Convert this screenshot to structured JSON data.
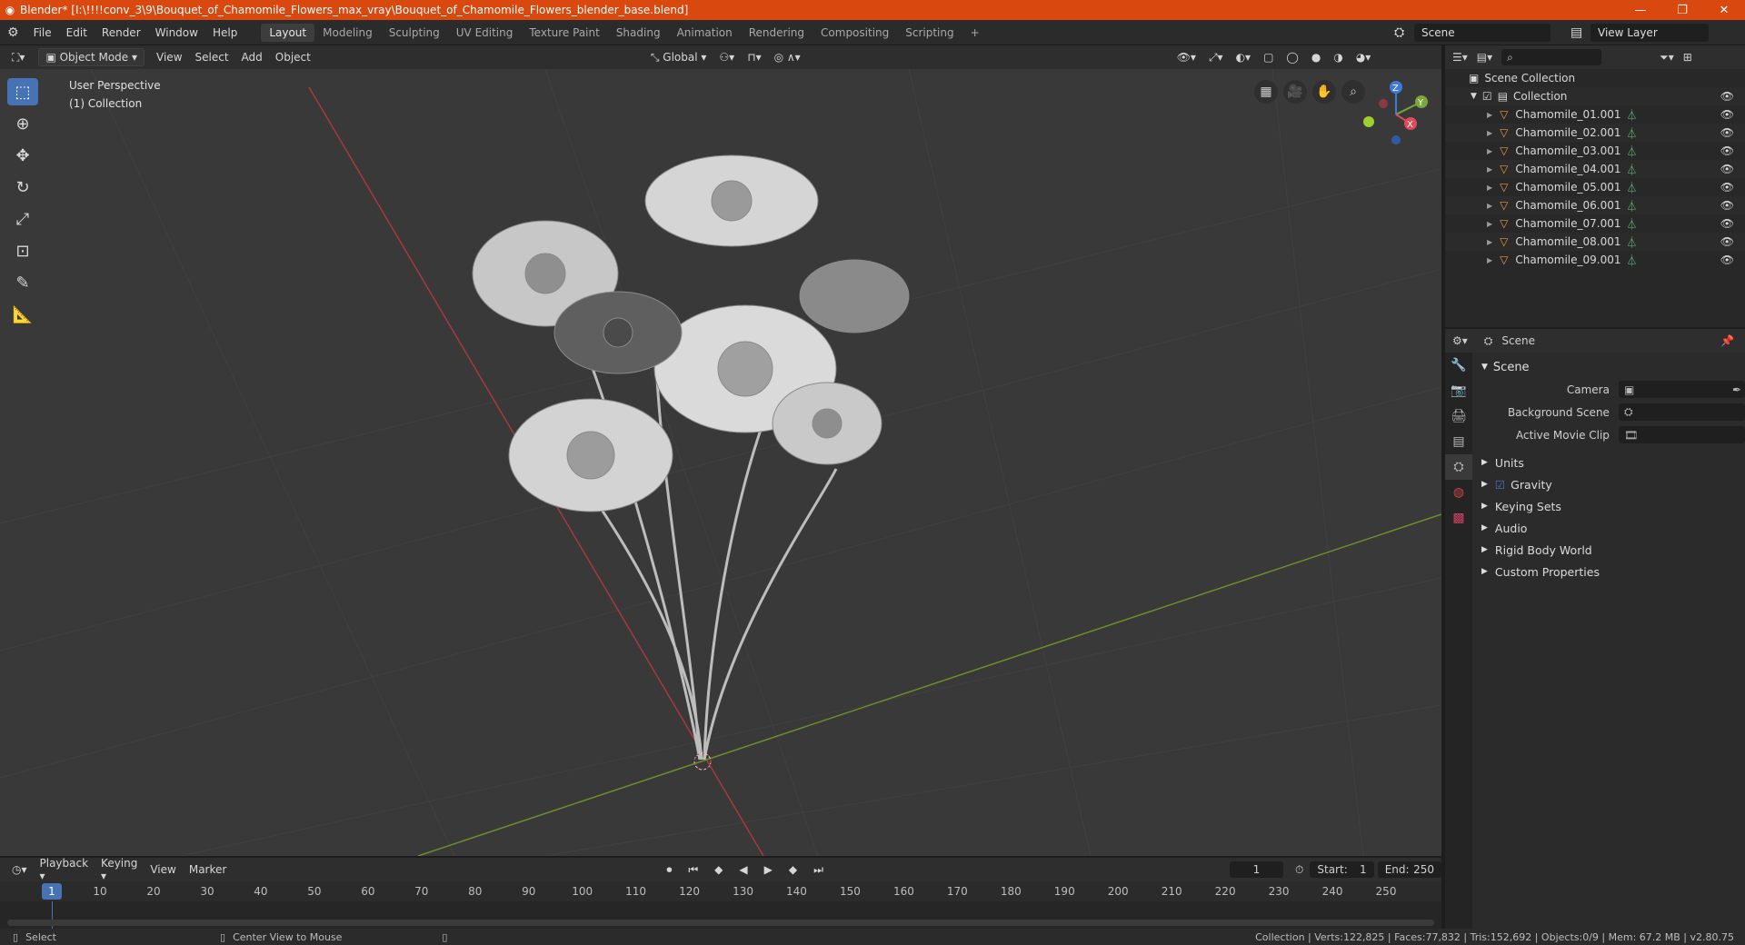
{
  "window": {
    "title": "Blender* [I:\\!!!!conv_3\\9\\Bouquet_of_Chamomile_Flowers_max_vray\\Bouquet_of_Chamomile_Flowers_blender_base.blend]",
    "min": "—",
    "max": "❐",
    "close": "✕"
  },
  "menu": [
    "File",
    "Edit",
    "Render",
    "Window",
    "Help"
  ],
  "workspaces": [
    "Layout",
    "Modeling",
    "Sculpting",
    "UV Editing",
    "Texture Paint",
    "Shading",
    "Animation",
    "Rendering",
    "Compositing",
    "Scripting"
  ],
  "workspace_add": "+",
  "scene_field": "Scene",
  "view_layer_field": "View Layer",
  "viewport_header": {
    "mode": "Object Mode",
    "menus": [
      "View",
      "Select",
      "Add",
      "Object"
    ],
    "transform": "Global"
  },
  "viewport": {
    "perspective": "User Perspective",
    "collection": "(1) Collection",
    "gizmo": {
      "z": "Z",
      "y": "Y",
      "x": "X"
    }
  },
  "outliner": {
    "search_placeholder": "",
    "root": "Scene Collection",
    "collection": "Collection",
    "objects": [
      "Chamomile_01.001",
      "Chamomile_02.001",
      "Chamomile_03.001",
      "Chamomile_04.001",
      "Chamomile_05.001",
      "Chamomile_06.001",
      "Chamomile_07.001",
      "Chamomile_08.001",
      "Chamomile_09.001"
    ]
  },
  "properties": {
    "context": "Scene",
    "panel": "Scene",
    "rows": [
      {
        "label": "Camera",
        "value": ""
      },
      {
        "label": "Background Scene",
        "value": ""
      },
      {
        "label": "Active Movie Clip",
        "value": ""
      }
    ],
    "subpanels": [
      "Units",
      "Gravity",
      "Keying Sets",
      "Audio",
      "Rigid Body World",
      "Custom Properties"
    ]
  },
  "timeline": {
    "menus": [
      "Playback",
      "Keying",
      "View",
      "Marker"
    ],
    "current_frame": "1",
    "start_label": "Start:",
    "start": "1",
    "end_label": "End:",
    "end": "250",
    "ruler": [
      "1",
      "10",
      "20",
      "30",
      "40",
      "50",
      "60",
      "70",
      "80",
      "90",
      "100",
      "110",
      "120",
      "130",
      "140",
      "150",
      "160",
      "170",
      "180",
      "190",
      "200",
      "210",
      "220",
      "230",
      "240",
      "250"
    ]
  },
  "statusbar": {
    "left1": "Select",
    "left2": "Center View to Mouse",
    "right": "Collection | Verts:122,825 | Faces:77,832 | Tris:152,692 | Objects:0/9 | Mem: 67.2 MB | v2.80.75"
  }
}
